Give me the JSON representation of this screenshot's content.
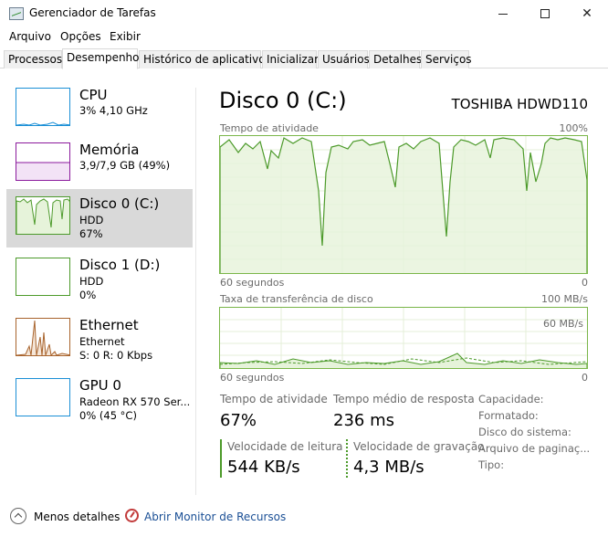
{
  "window": {
    "title": "Gerenciador de Tarefas",
    "controls": {
      "minimize": "minimize",
      "maximize": "maximize",
      "close": "✕"
    }
  },
  "menu": [
    "Arquivo",
    "Opções",
    "Exibir"
  ],
  "tabs": [
    "Processos",
    "Desempenho",
    "Histórico de aplicativos",
    "Inicializar",
    "Usuários",
    "Detalhes",
    "Serviços"
  ],
  "active_tab": "Desempenho",
  "sidebar": [
    {
      "name": "CPU",
      "line1": "3% 4,10 GHz",
      "line2": "",
      "color": "#1a8fd6"
    },
    {
      "name": "Memória",
      "line1": "3,9/7,9 GB (49%)",
      "line2": "",
      "color": "#8b1a9c"
    },
    {
      "name": "Disco 0 (C:)",
      "line1": "HDD",
      "line2": "67%",
      "color": "#4c9a2a"
    },
    {
      "name": "Disco 1 (D:)",
      "line1": "HDD",
      "line2": "0%",
      "color": "#4c9a2a"
    },
    {
      "name": "Ethernet",
      "line1": "Ethernet",
      "line2": "S: 0 R: 0 Kbps",
      "color": "#a8632c"
    },
    {
      "name": "GPU 0",
      "line1": "Radeon RX 570 Ser...",
      "line2": "0% (45 °C)",
      "color": "#1a8fd6"
    }
  ],
  "detail": {
    "title": "Disco 0 (C:)",
    "model": "TOSHIBA HDWD110",
    "graph1": {
      "label": "Tempo de atividade",
      "max": "100%",
      "time": "60 segundos",
      "min": "0"
    },
    "graph2": {
      "label": "Taxa de transferência de disco",
      "max": "100 MB/s",
      "mid": "60 MB/s",
      "time": "60 segundos",
      "min": "0"
    },
    "stats": {
      "active_label": "Tempo de atividade",
      "active_value": "67%",
      "response_label": "Tempo médio de resposta",
      "response_value": "236 ms",
      "read_label": "Velocidade de leitura",
      "read_value": "544 KB/s",
      "write_label": "Velocidade de gravação",
      "write_value": "4,3 MB/s"
    },
    "properties": [
      "Capacidade:",
      "Formatado:",
      "Disco do sistema:",
      "Arquivo de paginaç...",
      "Tipo:"
    ]
  },
  "footer": {
    "less_details": "Menos detalhes",
    "resource_monitor": "Abrir Monitor de Recursos"
  },
  "colors": {
    "disk_green": "#4c9a2a",
    "graph_fill": "#e6f3da",
    "grid": "#e4efd9"
  }
}
